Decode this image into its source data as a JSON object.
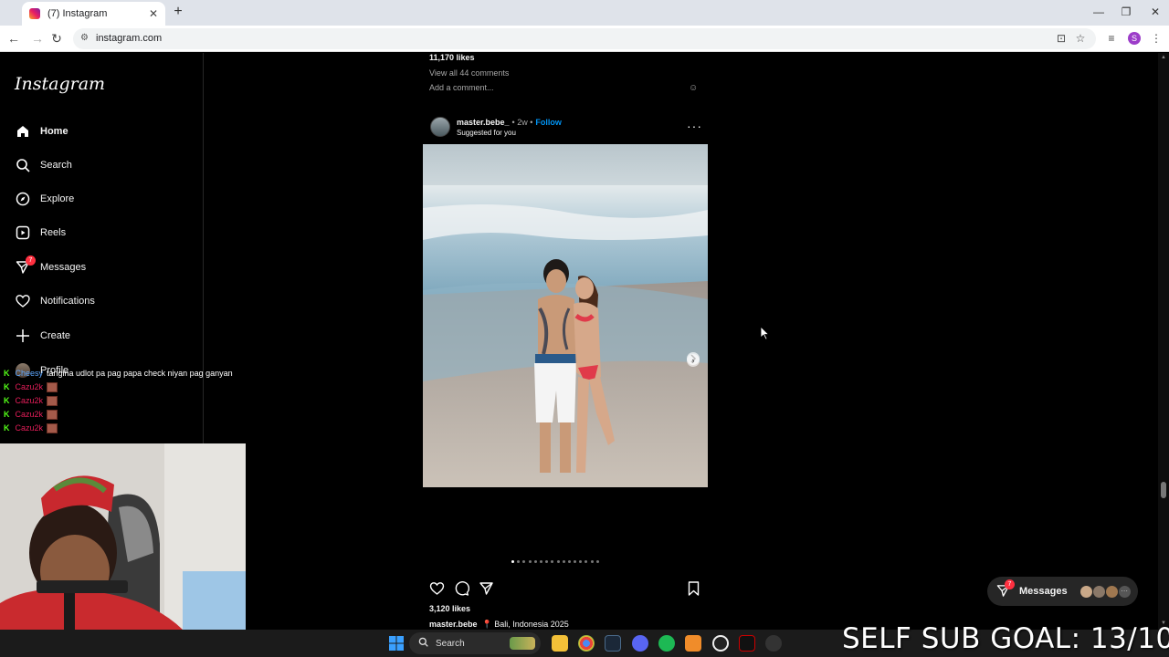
{
  "browser": {
    "tab_title": "(7) Instagram",
    "new_tab_icon": "plus-icon",
    "url": "instagram.com",
    "profile_letter": "S"
  },
  "sidebar": {
    "logo": "Instagram",
    "items": [
      {
        "label": "Home",
        "icon": "home-icon"
      },
      {
        "label": "Search",
        "icon": "search-icon"
      },
      {
        "label": "Explore",
        "icon": "compass-icon"
      },
      {
        "label": "Reels",
        "icon": "reels-icon"
      },
      {
        "label": "Messages",
        "icon": "messages-icon",
        "badge": "7"
      },
      {
        "label": "Notifications",
        "icon": "heart-icon"
      },
      {
        "label": "Create",
        "icon": "plus-icon"
      },
      {
        "label": "Profile",
        "icon": "avatar"
      }
    ]
  },
  "chat": [
    {
      "user": "Cheesy",
      "message": "tangina udlot pa pag papa check niyan pag ganyan"
    },
    {
      "user": "Cazu2k",
      "message": ""
    },
    {
      "user": "Cazu2k",
      "message": ""
    },
    {
      "user": "Cazu2k",
      "message": ""
    },
    {
      "user": "Cazu2k",
      "message": ""
    }
  ],
  "prev_post": {
    "likes": "11,170 likes",
    "view_comments": "View all 44 comments",
    "add_comment_placeholder": "Add a comment..."
  },
  "post": {
    "username": "master.bebe_",
    "age": "• 2w •",
    "follow": "Follow",
    "subtitle": "Suggested for you",
    "more_icon": "more-icon",
    "likes": "3,120 likes",
    "caption_user": "master.bebe",
    "location": "📍 Bali, Indonesia 2025",
    "carousel_dots": 16
  },
  "messages_pill": {
    "label": "Messages",
    "badge": "7"
  },
  "taskbar": {
    "search_label": "Search"
  },
  "overlay": {
    "sub_goal": "SELF SUB GOAL: 13/10"
  },
  "colors": {
    "instagram_blue": "#0095f6",
    "badge_red": "#ff3040",
    "kick_green": "#53fc18"
  }
}
